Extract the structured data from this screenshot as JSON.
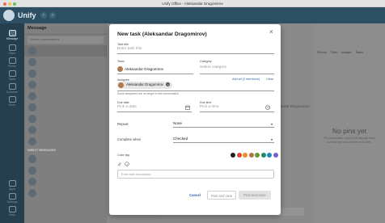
{
  "window": {
    "title": "Unify Office - Aleksandar Dragomirov"
  },
  "app": {
    "name": "Unify"
  },
  "rail": {
    "items": [
      {
        "label": "Message",
        "icon": "chat-icon"
      },
      {
        "label": "Video",
        "icon": "video-icon"
      },
      {
        "label": "Phone",
        "icon": "phone-icon"
      },
      {
        "label": "Tasks",
        "icon": "tasks-icon"
      },
      {
        "label": "Contacts",
        "icon": "contacts-icon"
      },
      {
        "label": "More",
        "icon": "more-icon"
      },
      {
        "label": "Apps",
        "icon": "apps-icon"
      },
      {
        "label": "Settings",
        "icon": "settings-icon"
      },
      {
        "label": "Help",
        "icon": "help-icon"
      }
    ]
  },
  "messages": {
    "header": "Message",
    "search": "Search conversations",
    "section": "DIRECT MESSAGES"
  },
  "right_panel": {
    "tabs": [
      "Pinned",
      "Files",
      "Images",
      "Tasks"
    ],
    "empty_title": "No pins yet",
    "empty_desc": "Pin information and it will appear here so that you can reference it later."
  },
  "modal": {
    "title": "New task (Aleksandar Dragomirov)",
    "task_title": {
      "label": "Task title",
      "placeholder": "Enter task title"
    },
    "team": {
      "label": "Team",
      "value": "Aleksandar Dragomirov"
    },
    "category": {
      "label": "Category",
      "placeholder": "Select category"
    },
    "assignee": {
      "label": "Assignee",
      "chip": "Aleksandar Dragomirov",
      "add_all_link": "Add all (2 members)",
      "clear_link": "Clear",
      "note": "Some assignees are no longer in this conversation."
    },
    "due_date": {
      "label": "Due date",
      "placeholder": "Pick a date"
    },
    "due_time": {
      "label": "Due time",
      "placeholder": "Pick a time"
    },
    "repeat": {
      "label": "Repeat",
      "value": "None"
    },
    "complete_when": {
      "label": "Complete when",
      "value": "Checked"
    },
    "color_tag": {
      "label": "Color tag",
      "colors": [
        "#1e1e1e",
        "#e2492f",
        "#f08a24",
        "#b07a3a",
        "#5e9e3a",
        "#1f8a6e",
        "#2a86b9",
        "#7b61c6"
      ]
    },
    "description": {
      "placeholder": "Enter task description"
    },
    "buttons": {
      "cancel": "Cancel",
      "post_and_view": "Post and view",
      "post_and_close": "Post and close"
    }
  },
  "chat": {
    "fragment": "andar Dragomirov",
    "bottom_fragment": "Post reply"
  }
}
